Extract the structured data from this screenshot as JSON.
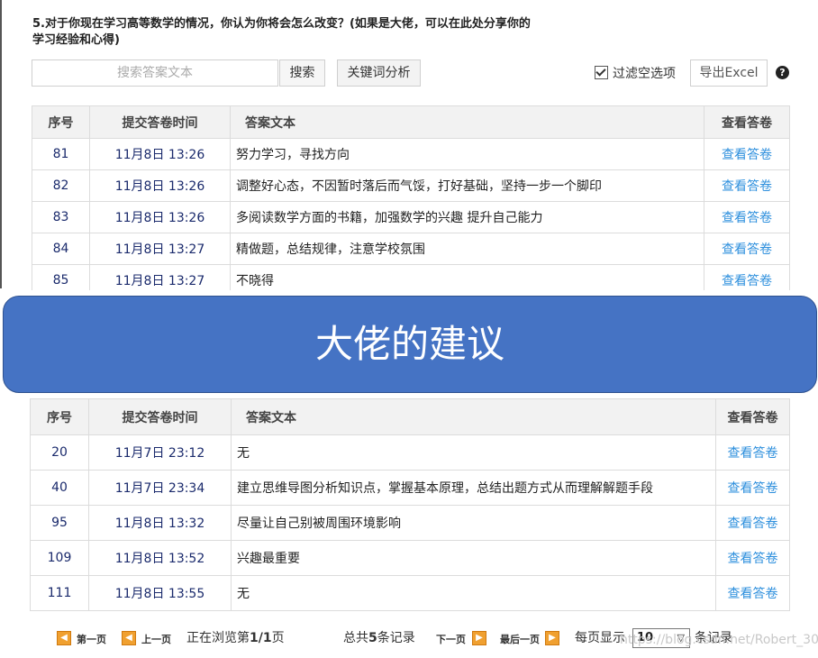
{
  "question": {
    "line1": "5.对于你现在学习高等数学的情况，你认为你将会怎么改变？(如果是大佬，可以在此处分享你的",
    "line2": "学习经验和心得)"
  },
  "toolbar": {
    "search_placeholder": "搜索答案文本",
    "search_button": "搜索",
    "keyword_button": "关键词分析",
    "filter_label": "过滤空选项",
    "filter_checked": true,
    "export_button": "导出Excel",
    "help_icon": "?"
  },
  "table_headers": {
    "index": "序号",
    "time": "提交答卷时间",
    "answer": "答案文本",
    "view": "查看答卷"
  },
  "table1_rows": [
    {
      "index": "81",
      "time": "11月8日 13:26",
      "answer": "努力学习，寻找方向",
      "view": "查看答卷"
    },
    {
      "index": "82",
      "time": "11月8日 13:26",
      "answer": "调整好心态，不因暂时落后而气馁，打好基础，坚持一步一个脚印",
      "view": "查看答卷"
    },
    {
      "index": "83",
      "time": "11月8日 13:26",
      "answer": "多阅读数学方面的书籍，加强数学的兴趣 提升自己能力",
      "view": "查看答卷"
    },
    {
      "index": "84",
      "time": "11月8日 13:27",
      "answer": "精做题，总结规律，注意学校氛围",
      "view": "查看答卷"
    },
    {
      "index": "85",
      "time": "11月8日 13:27",
      "answer": "不晓得",
      "view": "查看答卷"
    }
  ],
  "banner": {
    "text": "大佬的建议",
    "color": "#4573c4"
  },
  "table2_rows": [
    {
      "index": "20",
      "time": "11月7日 23:12",
      "answer": "无",
      "view": "查看答卷"
    },
    {
      "index": "40",
      "time": "11月7日 23:34",
      "answer": "建立思维导图分析知识点，掌握基本原理，总结出题方式从而理解解题手段",
      "view": "查看答卷"
    },
    {
      "index": "95",
      "time": "11月8日 13:32",
      "answer": "尽量让自己别被周围环境影响",
      "view": "查看答卷"
    },
    {
      "index": "109",
      "time": "11月8日 13:52",
      "answer": "兴趣最重要",
      "view": "查看答卷"
    },
    {
      "index": "111",
      "time": "11月8日 13:55",
      "answer": "无",
      "view": "查看答卷"
    }
  ],
  "pager": {
    "first": "第一页",
    "prev": "上一页",
    "browsing_prefix": "正在浏览第",
    "browsing_page": "1/1",
    "browsing_suffix": "页",
    "total_prefix": "总共",
    "total_count": "5",
    "total_suffix": "条记录",
    "next": "下一页",
    "last": "最后一页",
    "per_page_label": "每页显示",
    "per_page_value": "10",
    "records_label": "条记录"
  },
  "watermark": "https://blog.csdn.net/Robert_30",
  "colors": {
    "link": "#2d8fdd",
    "number": "#1a2a6c",
    "pager_icon": "#f0a030"
  }
}
